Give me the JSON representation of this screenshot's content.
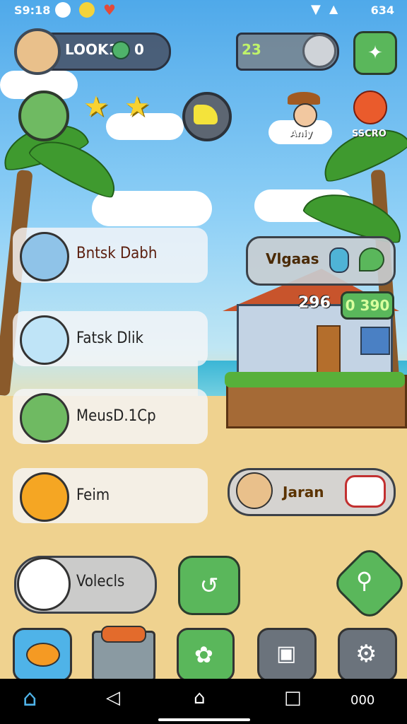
{
  "status_bar": {
    "time": "S9:18",
    "battery": "634"
  },
  "hud": {
    "player_label": "LOOK1",
    "gem_count": "0",
    "coins": "23"
  },
  "npc": {
    "label": "Aniy",
    "heart_label": "SSCRO"
  },
  "menu": {
    "items": [
      {
        "label": "Bntsk Dabh"
      },
      {
        "label": "Fatsk Dlik"
      },
      {
        "label": "MeusD.1Cp"
      },
      {
        "label": "Feim"
      }
    ]
  },
  "villages": {
    "label": "Vlgaas"
  },
  "house": {
    "count_a": "296",
    "count_b": "0 390"
  },
  "joran": {
    "label": "Jaran"
  },
  "vokels": {
    "label": "Volecls"
  },
  "nav": {
    "right_label": "000"
  },
  "colors": {
    "accent_green": "#5ab75b",
    "sky": "#4fa9ea",
    "sand": "#efd28f"
  }
}
